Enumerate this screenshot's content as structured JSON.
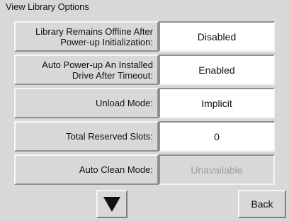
{
  "window": {
    "title": "View Library Options"
  },
  "options": [
    {
      "label_line1": "Library Remains Offline After",
      "label_line2": "Power-up Initialization:",
      "value": "Disabled",
      "state": "enabled"
    },
    {
      "label_line1": "Auto Power-up An Installed",
      "label_line2": "Drive After Timeout:",
      "value": "Enabled",
      "state": "enabled"
    },
    {
      "label_line1": "Unload Mode:",
      "label_line2": "",
      "value": "Implicit",
      "state": "enabled"
    },
    {
      "label_line1": "Total Reserved Slots:",
      "label_line2": "",
      "value": "0",
      "state": "enabled"
    },
    {
      "label_line1": "Auto Clean Mode:",
      "label_line2": "",
      "value": "Unavailable",
      "state": "disabled"
    }
  ],
  "controls": {
    "down_icon": "down-triangle-icon",
    "back_label": "Back"
  },
  "colors": {
    "panel_background": "#d8d8d8",
    "value_background": "#ffffff",
    "disabled_text": "#9c9c9c"
  }
}
